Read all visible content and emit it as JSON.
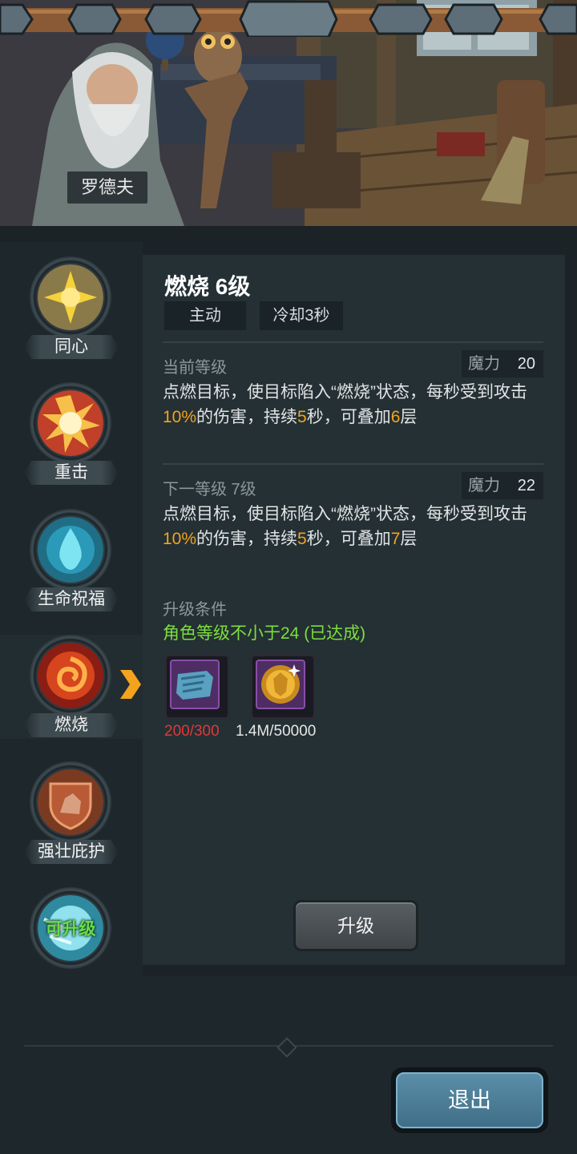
{
  "character": {
    "name": "罗德夫"
  },
  "skills": [
    {
      "label": "同心",
      "icon": "sun-icon"
    },
    {
      "label": "重击",
      "icon": "burst-icon"
    },
    {
      "label": "生命祝福",
      "icon": "water-drop-icon"
    },
    {
      "label": "燃烧",
      "icon": "fire-swirl-icon",
      "selected": true
    },
    {
      "label": "强壮庇护",
      "icon": "rock-shield-icon"
    },
    {
      "label": "",
      "icon": "lightning-orb-icon",
      "status": "可升级"
    }
  ],
  "detail": {
    "title": "燃烧 6级",
    "tags": [
      "主动",
      "冷却3秒"
    ],
    "current": {
      "label": "当前等级",
      "mana_label": "魔力",
      "mana_value": "20",
      "desc_prefix": "点燃目标，使目标陷入“燃烧”状态，每秒受到攻击",
      "pct": "10%",
      "desc_mid": "的伤害，持续",
      "secs": "5",
      "desc_mid2": "秒，可叠加",
      "stacks": "6",
      "desc_end": "层"
    },
    "next": {
      "label": "下一等级 7级",
      "mana_label": "魔力",
      "mana_value": "22",
      "desc_prefix": "点燃目标，使目标陷入“燃烧”状态，每秒受到攻击",
      "pct": "10%",
      "desc_mid": "的伤害，持续",
      "secs": "5",
      "desc_mid2": "秒，可叠加",
      "stacks": "7",
      "desc_end": "层"
    },
    "upgrade_cond_label": "升级条件",
    "upgrade_cond": "角色等级不小于24 (已达成)",
    "materials": [
      {
        "icon": "scroll-icon",
        "have": "200",
        "need": "300",
        "sep": "/"
      },
      {
        "icon": "gold-coin-icon",
        "amount": "1.4M/50000"
      }
    ],
    "upgrade_button": "升级"
  },
  "exit_button": "退出",
  "colors": {
    "highlight": "#f3a31e",
    "ok": "#7ddf3c",
    "insufficient": "#e0383a"
  }
}
